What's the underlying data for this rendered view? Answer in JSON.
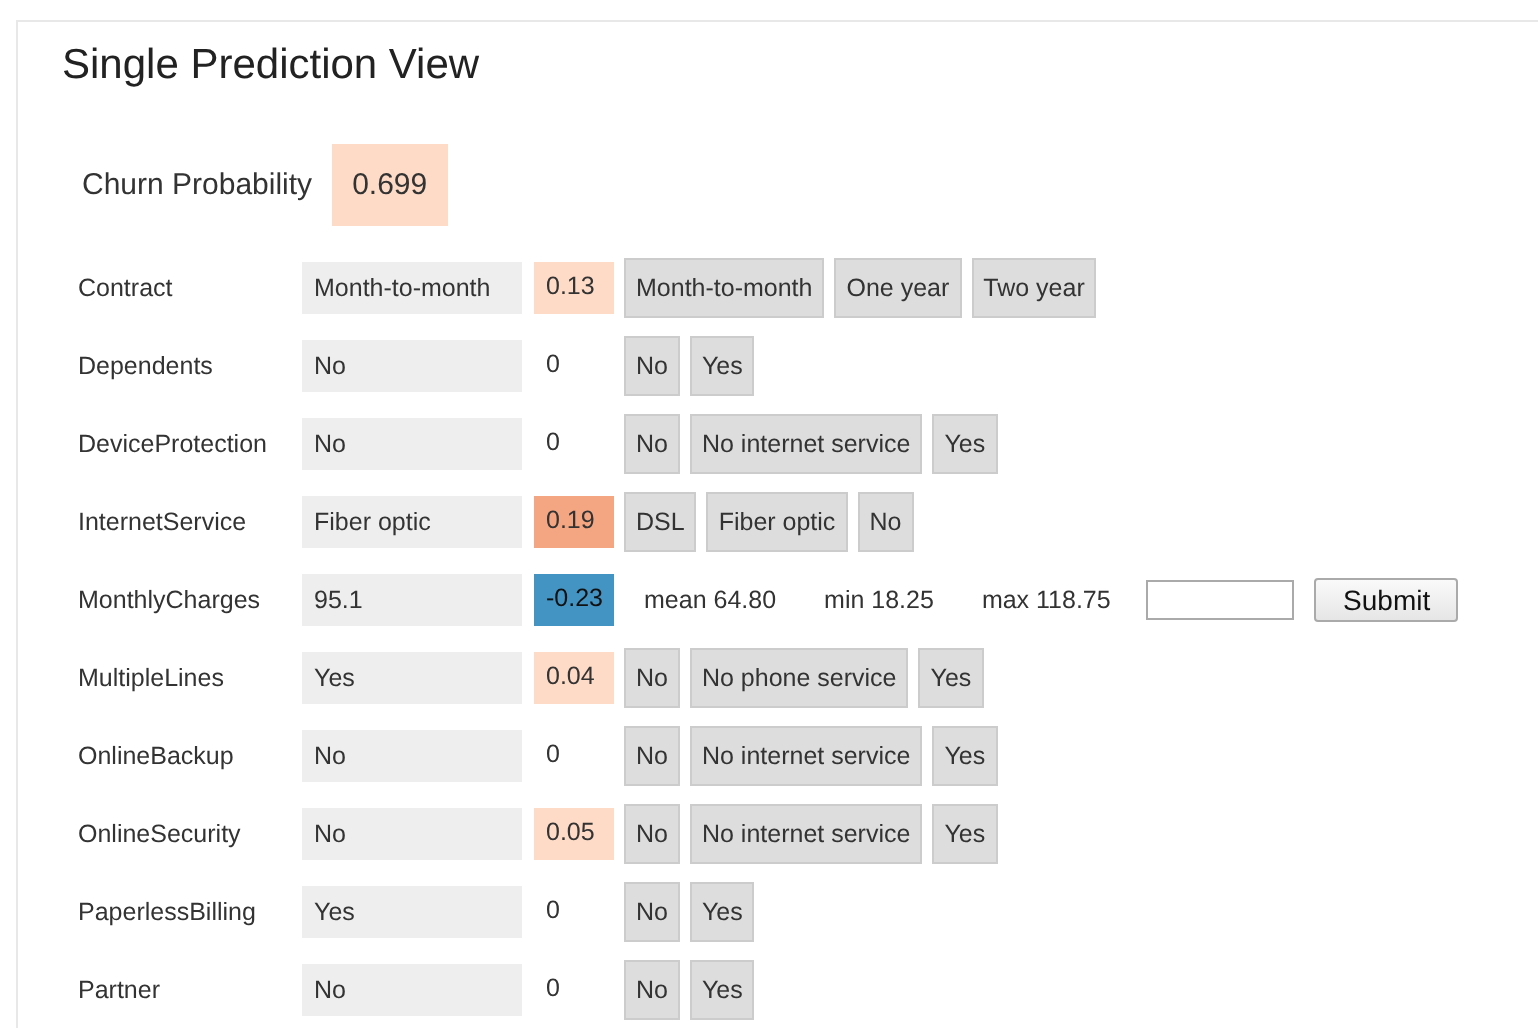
{
  "title": "Single Prediction View",
  "churn": {
    "label": "Churn Probability",
    "value": "0.699",
    "color": "#fddbc7"
  },
  "features": [
    {
      "kind": "categorical",
      "name": "Contract",
      "value": "Month-to-month",
      "effect": "0.13",
      "color": "#fddbc7",
      "options": [
        "Month-to-month",
        "One year",
        "Two year"
      ]
    },
    {
      "kind": "categorical",
      "name": "Dependents",
      "value": "No",
      "effect": "0",
      "options": [
        "No",
        "Yes"
      ]
    },
    {
      "kind": "categorical",
      "name": "DeviceProtection",
      "value": "No",
      "effect": "0",
      "options": [
        "No",
        "No internet service",
        "Yes"
      ]
    },
    {
      "kind": "categorical",
      "name": "InternetService",
      "value": "Fiber optic",
      "effect": "0.19",
      "color": "#f4a582",
      "options": [
        "DSL",
        "Fiber optic",
        "No"
      ]
    },
    {
      "kind": "numeric",
      "name": "MonthlyCharges",
      "value": "95.1",
      "effect": "-0.23",
      "color": "#4393c3",
      "mean": "mean 64.80",
      "min": "min 18.25",
      "max": "max 118.75",
      "button": "Submit"
    },
    {
      "kind": "categorical",
      "name": "MultipleLines",
      "value": "Yes",
      "effect": "0.04",
      "color": "#fddbc7",
      "options": [
        "No",
        "No phone service",
        "Yes"
      ]
    },
    {
      "kind": "categorical",
      "name": "OnlineBackup",
      "value": "No",
      "effect": "0",
      "options": [
        "No",
        "No internet service",
        "Yes"
      ]
    },
    {
      "kind": "categorical",
      "name": "OnlineSecurity",
      "value": "No",
      "effect": "0.05",
      "color": "#fddbc7",
      "options": [
        "No",
        "No internet service",
        "Yes"
      ]
    },
    {
      "kind": "categorical",
      "name": "PaperlessBilling",
      "value": "Yes",
      "effect": "0",
      "options": [
        "No",
        "Yes"
      ]
    },
    {
      "kind": "categorical",
      "name": "Partner",
      "value": "No",
      "effect": "0",
      "options": [
        "No",
        "Yes"
      ]
    }
  ]
}
